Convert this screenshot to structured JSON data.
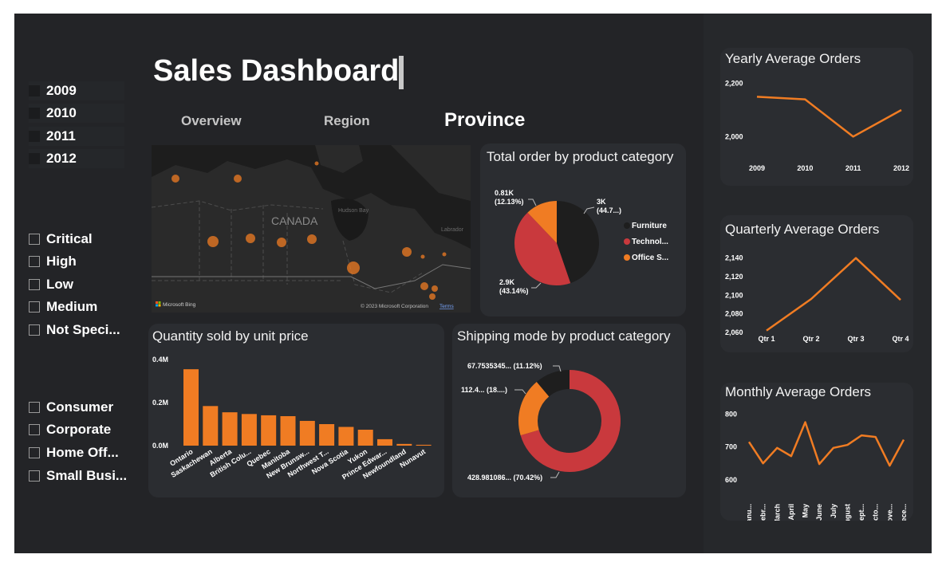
{
  "header": {
    "title": "Sales Dashboard"
  },
  "nav": {
    "tabs": [
      {
        "label": "Overview"
      },
      {
        "label": "Region"
      },
      {
        "label": "Province"
      }
    ]
  },
  "slicers": {
    "years": [
      "2009",
      "2010",
      "2011",
      "2012"
    ],
    "priorities": [
      "Critical",
      "High",
      "Low",
      "Medium",
      "Not Speci..."
    ],
    "segments": [
      "Consumer",
      "Corporate",
      "Home Off...",
      "Small Busi..."
    ]
  },
  "map": {
    "label": "CANADA",
    "bay_label": "Hudson Bay",
    "east_label": "Labrador",
    "bing": "Microsoft Bing",
    "copyright": "© 2023 Microsoft Corporation",
    "terms": "Terms"
  },
  "colors": {
    "accent": "#f07c23",
    "red": "#c9393d",
    "dark": "#1e1e1e",
    "card": "#2b2d31",
    "bg": "#232427"
  },
  "charts": {
    "pie": {
      "title": "Total order by product category"
    },
    "bar": {
      "title": "Quantity sold by unit price"
    },
    "donut": {
      "title": "Shipping mode by product  category"
    },
    "yearly": {
      "title": "Yearly Average Orders"
    },
    "quarterly": {
      "title": "Quarterly Average  Orders"
    },
    "monthly": {
      "title": "Monthly Average  Orders"
    }
  },
  "chart_data": [
    {
      "id": "pie",
      "type": "pie",
      "title": "Total order by product category",
      "slices": [
        {
          "name": "Furniture",
          "value": 3.0,
          "pct": 44.73,
          "label": "3K",
          "pct_label": "(44.7...)",
          "color": "#1e1e1e"
        },
        {
          "name": "Technol...",
          "value": 2.9,
          "pct": 43.14,
          "label": "2.9K",
          "pct_label": "(43.14%)",
          "color": "#c9393d"
        },
        {
          "name": "Office S...",
          "value": 0.81,
          "pct": 12.13,
          "label": "0.81K",
          "pct_label": "(12.13%)",
          "color": "#f07c23"
        }
      ],
      "legend": [
        "Furniture",
        "Technol...",
        "Office S..."
      ]
    },
    {
      "id": "bar",
      "type": "bar",
      "title": "Quantity sold by unit price",
      "categories": [
        "Ontario",
        "Saskachewan",
        "Alberta",
        "British Colu...",
        "Quebec",
        "Manitoba",
        "New Brunsw...",
        "Northwest T...",
        "Nova Scotia",
        "Yukon",
        "Prince Edwar...",
        "Newfoundland",
        "Nunavut"
      ],
      "values": [
        0.355,
        0.184,
        0.155,
        0.147,
        0.141,
        0.137,
        0.115,
        0.1,
        0.087,
        0.074,
        0.03,
        0.008,
        0.004
      ],
      "ylim": [
        0,
        0.4
      ],
      "ytick_labels": [
        "0.0M",
        "0.2M",
        "0.4M"
      ],
      "ytick_values": [
        0,
        0.2,
        0.4
      ],
      "color": "#f07c23"
    },
    {
      "id": "donut",
      "type": "pie",
      "title": "Shipping mode by product  category",
      "slices": [
        {
          "label": "428.981086... (70.42%)",
          "pct": 70.42,
          "color": "#c9393d"
        },
        {
          "label": "112.4... (18....)",
          "pct": 18.46,
          "color": "#f07c23"
        },
        {
          "label": "67.7535345... (11.12%)",
          "pct": 11.12,
          "color": "#1e1e1e"
        }
      ]
    },
    {
      "id": "yearly",
      "type": "line",
      "title": "Yearly Average Orders",
      "x": [
        "2009",
        "2010",
        "2011",
        "2012"
      ],
      "values": [
        2150,
        2140,
        2000,
        2100
      ],
      "ylim": [
        1920,
        2220
      ],
      "ytick_values": [
        2000,
        2200
      ],
      "ytick_labels": [
        "2,000",
        "2,200"
      ],
      "color": "#f07c23"
    },
    {
      "id": "quarterly",
      "type": "line",
      "title": "Quarterly Average  Orders",
      "x": [
        "Qtr 1",
        "Qtr 2",
        "Qtr 3",
        "Qtr 4"
      ],
      "values": [
        2062,
        2096,
        2140,
        2095
      ],
      "ylim": [
        2060,
        2150
      ],
      "ytick_values": [
        2060,
        2080,
        2100,
        2120,
        2140
      ],
      "ytick_labels": [
        "2,060",
        "2,080",
        "2,100",
        "2,120",
        "2,140"
      ],
      "color": "#f07c23"
    },
    {
      "id": "monthly",
      "type": "line",
      "title": "Monthly Average  Orders",
      "x": [
        "Janu...",
        "Febr...",
        "March",
        "April",
        "May",
        "June",
        "July",
        "August",
        "Sept...",
        "Octo...",
        "Nove...",
        "Dece..."
      ],
      "values": [
        715,
        650,
        697,
        672,
        775,
        648,
        697,
        706,
        735,
        730,
        643,
        722
      ],
      "ylim": [
        590,
        820
      ],
      "ytick_values": [
        600,
        700,
        800
      ],
      "ytick_labels": [
        "600",
        "700",
        "800"
      ],
      "color": "#f07c23"
    }
  ]
}
